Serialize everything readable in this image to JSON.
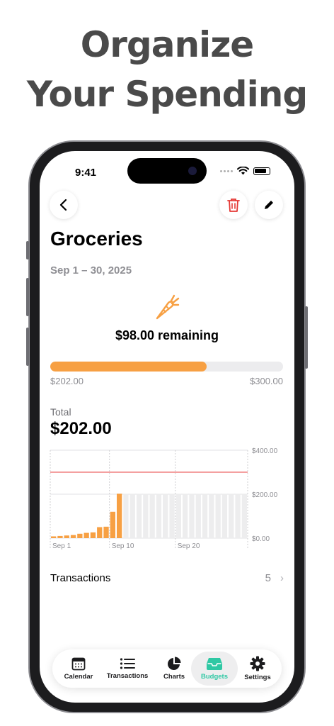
{
  "promo": {
    "line1": "Organize",
    "line2": "Your Spending"
  },
  "status": {
    "time": "9:41"
  },
  "budget": {
    "title": "Groceries",
    "date_range": "Sep 1 – 30, 2025",
    "icon": "carrot-icon",
    "remaining_text": "$98.00 remaining",
    "spent_label": "$202.00",
    "limit_label": "$300.00",
    "progress_fraction": 0.673,
    "total_label": "Total",
    "total_value": "$202.00"
  },
  "colors": {
    "accent": "#f7a043",
    "tab_active": "#2fc8a4",
    "limit_line": "#f08080",
    "delete": "#e53935"
  },
  "chart_data": {
    "type": "bar",
    "x_tick_labels": [
      "Sep 1",
      "Sep 10",
      "Sep 20"
    ],
    "y_tick_labels": [
      "$400.00",
      "$200.00",
      "$0.00"
    ],
    "ylim": [
      0,
      400
    ],
    "limit_line": 300,
    "days": [
      1,
      2,
      3,
      4,
      5,
      6,
      7,
      8,
      9,
      10,
      11,
      12,
      13,
      14,
      15,
      16,
      17,
      18,
      19,
      20,
      21,
      22,
      23,
      24,
      25,
      26,
      27,
      28,
      29,
      30
    ],
    "values": [
      8,
      10,
      12,
      14,
      20,
      24,
      26,
      50,
      52,
      120,
      202
    ],
    "future_value": 202
  },
  "transactions": {
    "label": "Transactions",
    "count": "5"
  },
  "tabs": [
    {
      "label": "Calendar",
      "icon": "calendar-icon"
    },
    {
      "label": "Transactions",
      "icon": "list-icon"
    },
    {
      "label": "Charts",
      "icon": "pie-chart-icon"
    },
    {
      "label": "Budgets",
      "icon": "tray-icon"
    },
    {
      "label": "Settings",
      "icon": "gear-icon"
    }
  ]
}
